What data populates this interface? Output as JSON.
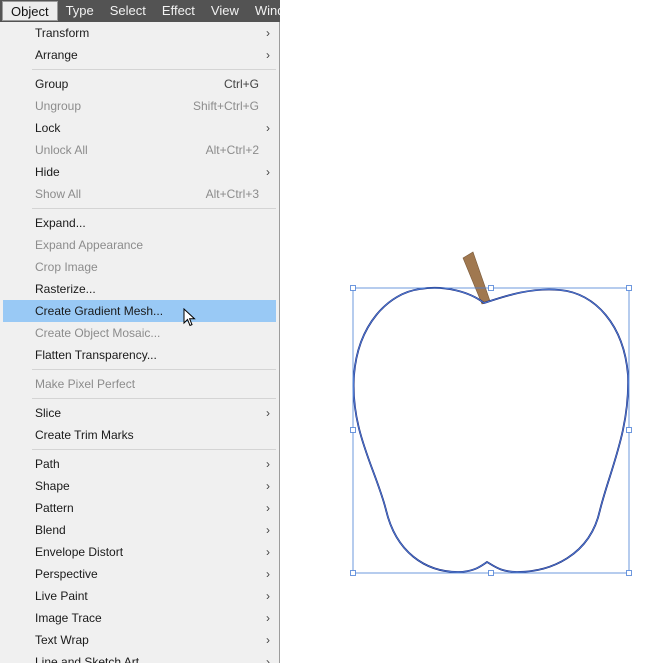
{
  "menubar": {
    "items": [
      {
        "label": "Object"
      },
      {
        "label": "Type"
      },
      {
        "label": "Select"
      },
      {
        "label": "Effect"
      },
      {
        "label": "View"
      },
      {
        "label": "Window"
      }
    ]
  },
  "menu": {
    "groups": [
      [
        {
          "label": "Transform",
          "submenu": true
        },
        {
          "label": "Arrange",
          "submenu": true
        }
      ],
      [
        {
          "label": "Group",
          "shortcut": "Ctrl+G"
        },
        {
          "label": "Ungroup",
          "shortcut": "Shift+Ctrl+G",
          "disabled": true
        },
        {
          "label": "Lock",
          "submenu": true
        },
        {
          "label": "Unlock All",
          "shortcut": "Alt+Ctrl+2",
          "disabled": true
        },
        {
          "label": "Hide",
          "submenu": true
        },
        {
          "label": "Show All",
          "shortcut": "Alt+Ctrl+3",
          "disabled": true
        }
      ],
      [
        {
          "label": "Expand..."
        },
        {
          "label": "Expand Appearance",
          "disabled": true
        },
        {
          "label": "Crop Image",
          "disabled": true
        },
        {
          "label": "Rasterize..."
        },
        {
          "label": "Create Gradient Mesh...",
          "highlighted": true
        },
        {
          "label": "Create Object Mosaic...",
          "disabled": true
        },
        {
          "label": "Flatten Transparency..."
        }
      ],
      [
        {
          "label": "Make Pixel Perfect",
          "disabled": true
        }
      ],
      [
        {
          "label": "Slice",
          "submenu": true
        },
        {
          "label": "Create Trim Marks"
        }
      ],
      [
        {
          "label": "Path",
          "submenu": true
        },
        {
          "label": "Shape",
          "submenu": true
        },
        {
          "label": "Pattern",
          "submenu": true
        },
        {
          "label": "Blend",
          "submenu": true
        },
        {
          "label": "Envelope Distort",
          "submenu": true
        },
        {
          "label": "Perspective",
          "submenu": true
        },
        {
          "label": "Live Paint",
          "submenu": true
        },
        {
          "label": "Image Trace",
          "submenu": true
        },
        {
          "label": "Text Wrap",
          "submenu": true
        },
        {
          "label": "Line and Sketch Art",
          "submenu": true
        }
      ]
    ]
  },
  "colors": {
    "menubar_bg": "#535353",
    "menu_bg": "#f0f0f0",
    "highlight": "#99c9f5",
    "selection_box": "#4a7fd6",
    "apple_outline": "#1a2a7a",
    "stem": "#a07850"
  },
  "icons": {
    "submenu": "chevron-right-icon",
    "pointer": "arrow-cursor-icon"
  }
}
